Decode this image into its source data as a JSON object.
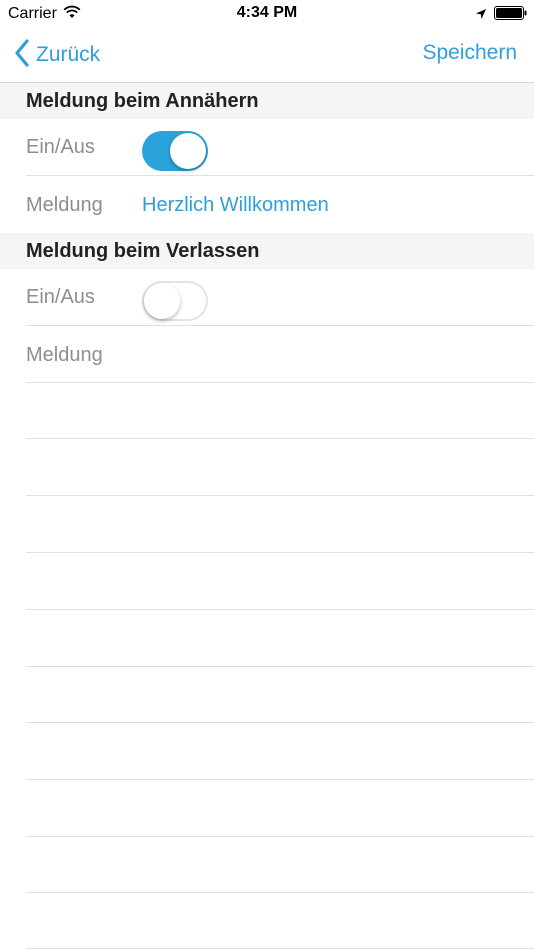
{
  "status_bar": {
    "carrier": "Carrier",
    "time": "4:34 PM",
    "icons": [
      "wifi-icon",
      "location-arrow-icon",
      "battery-icon"
    ]
  },
  "nav": {
    "back_label": "Zurück",
    "save_label": "Speichern",
    "accent_color": "#2f9fdc"
  },
  "sections": [
    {
      "title": "Meldung beim Annähern",
      "toggle_label": "Ein/Aus",
      "toggle_on": true,
      "message_label": "Meldung",
      "message_value": "Herzlich Willkommen"
    },
    {
      "title": "Meldung beim Verlassen",
      "toggle_label": "Ein/Aus",
      "toggle_on": false,
      "message_label": "Meldung",
      "message_value": ""
    }
  ]
}
